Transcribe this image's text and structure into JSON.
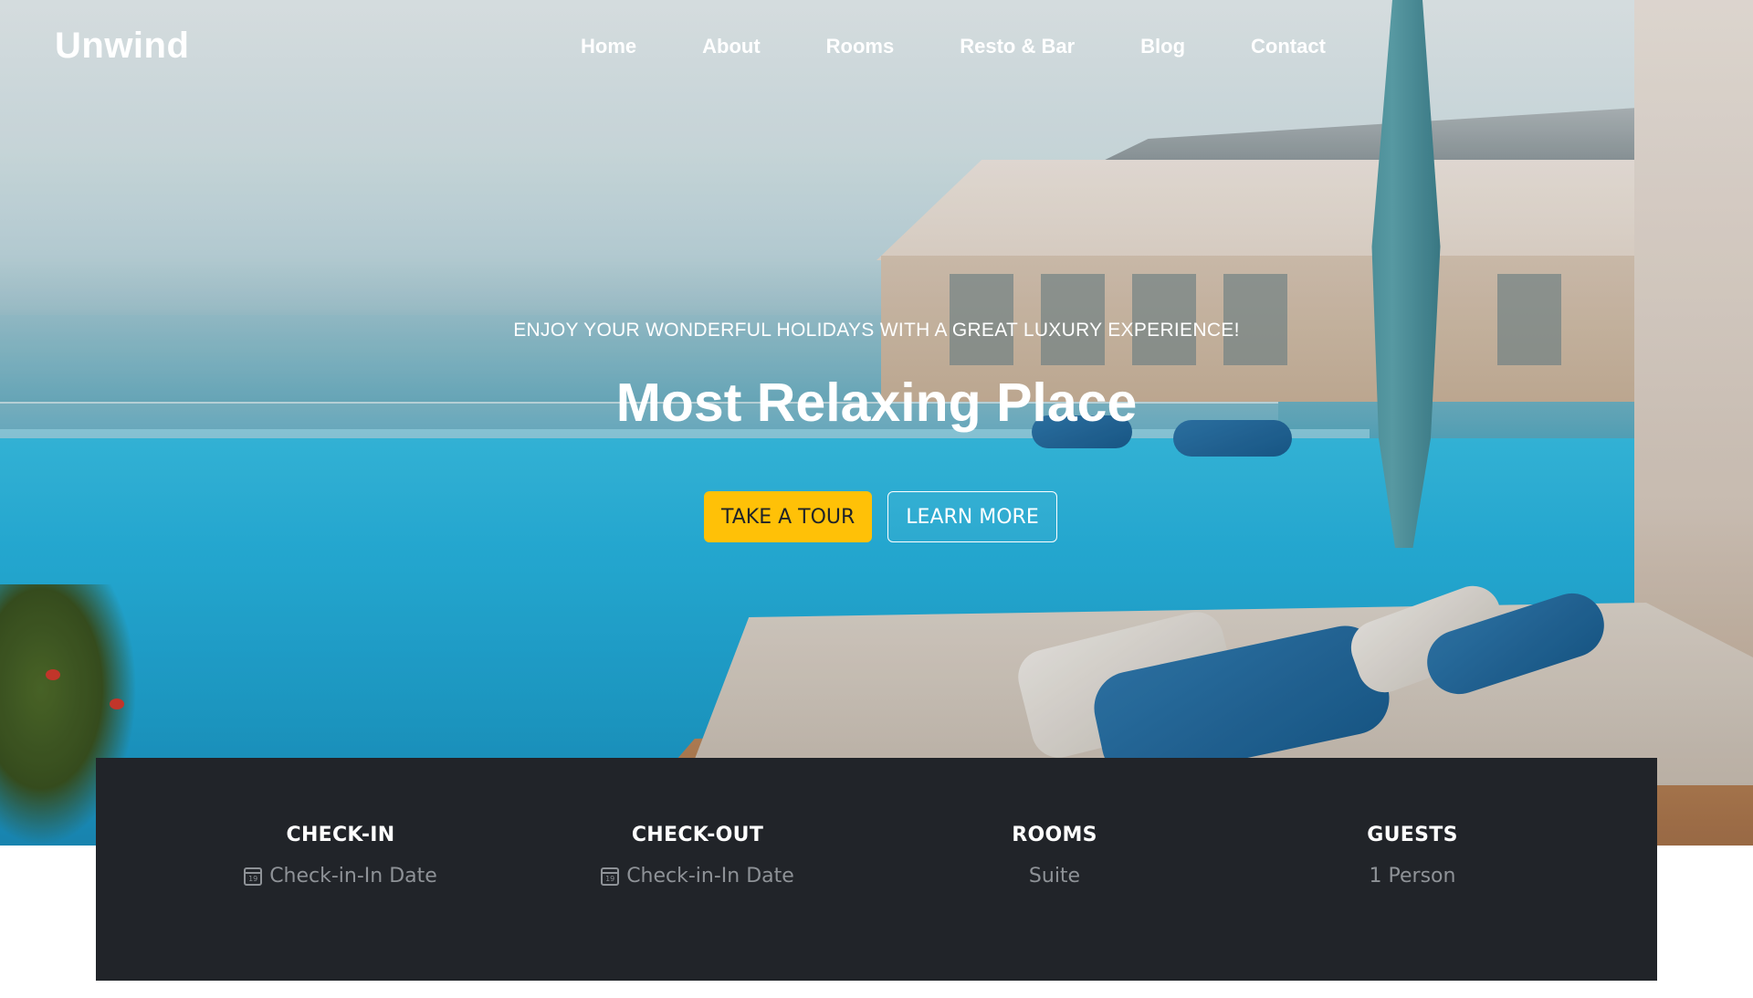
{
  "brand": "Unwind",
  "nav": {
    "items": [
      "Home",
      "About",
      "Rooms",
      "Resto & Bar",
      "Blog",
      "Contact"
    ]
  },
  "hero": {
    "tagline": "ENJOY YOUR WONDERFUL HOLIDAYS WITH A GREAT LUXURY EXPERIENCE!",
    "title": "Most Relaxing Place",
    "primary_button": "TAKE A TOUR",
    "secondary_button": "LEARN MORE",
    "background": "hotel infinity pool with sea view"
  },
  "booking": {
    "check_in": {
      "label": "CHECK-IN",
      "value": "Check-in-In Date",
      "icon": "calendar-icon",
      "icon_day": "19"
    },
    "check_out": {
      "label": "CHECK-OUT",
      "value": "Check-in-In Date",
      "icon": "calendar-icon",
      "icon_day": "19"
    },
    "rooms": {
      "label": "ROOMS",
      "value": "Suite"
    },
    "guests": {
      "label": "GUESTS",
      "value": "1 Person"
    }
  },
  "colors": {
    "accent": "#ffc107",
    "booking_bg": "#212429",
    "booking_value": "#8e9297",
    "text_light": "#ffffff"
  }
}
